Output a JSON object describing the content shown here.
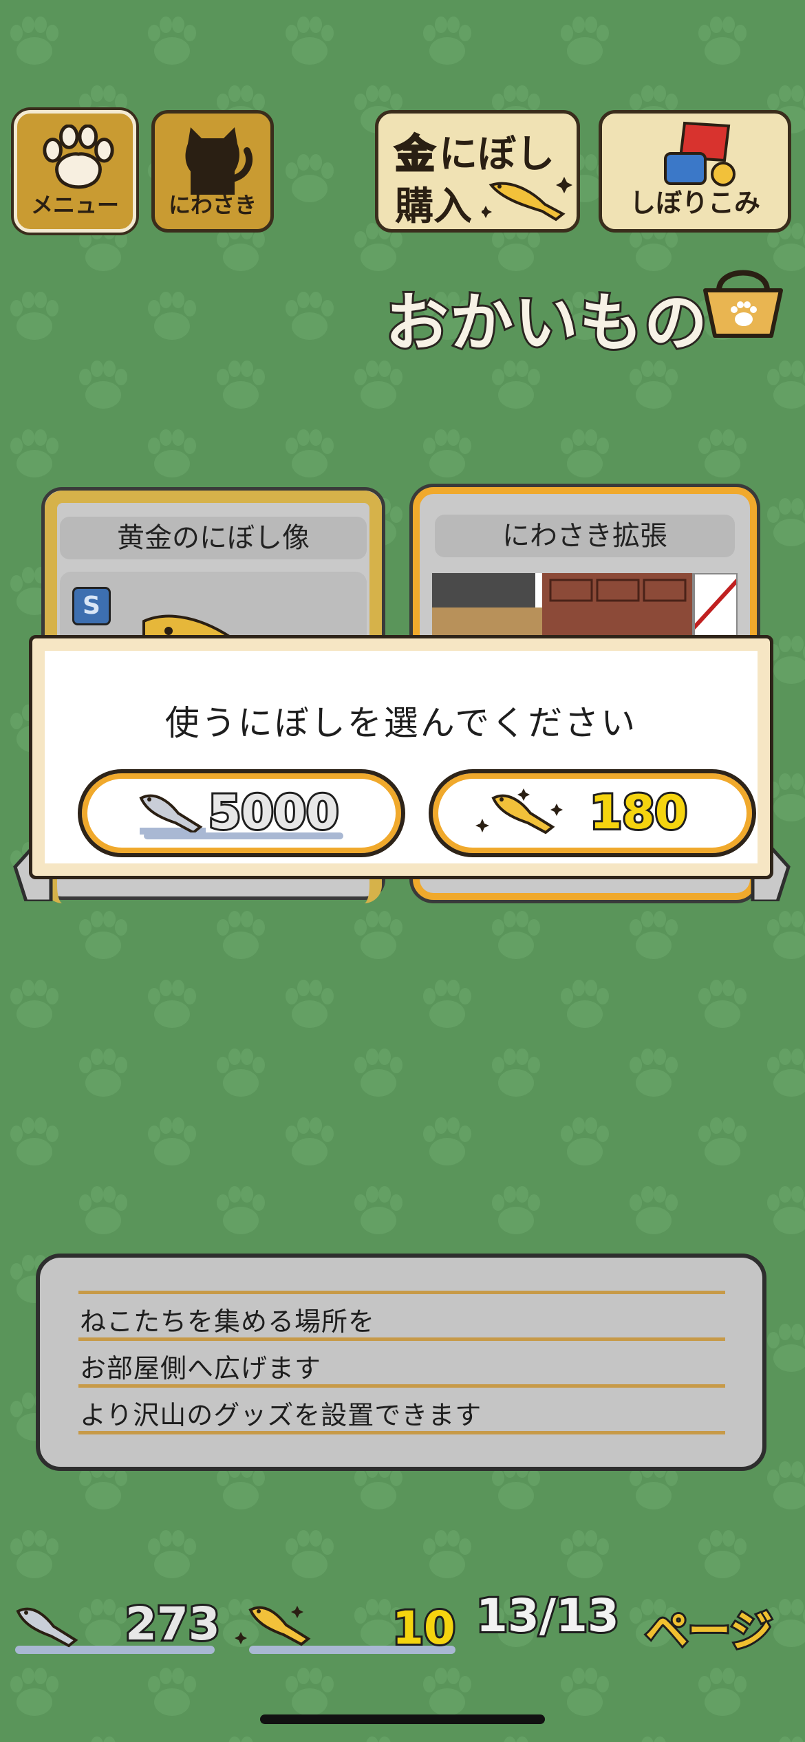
{
  "colors": {
    "background": "#5a955a",
    "gold": "#c99b32",
    "accent_orange": "#f0a92c",
    "yellow": "#f5d40f"
  },
  "top_buttons": {
    "menu_label": "メニュー",
    "yard_label": "にわさき",
    "buy_gold_line1_a": "金",
    "buy_gold_line1_b": "にぼし",
    "buy_gold_line2": "購入",
    "squeeze_label": "しぼりこみ"
  },
  "shop": {
    "title": "おかいもの",
    "icon": "basket-icon"
  },
  "cards": [
    {
      "title": "黄金のにぼし像",
      "badge": "S"
    },
    {
      "title": "にわさき拡張"
    }
  ],
  "modal": {
    "message": "使うにぼしを選んでください",
    "options": [
      {
        "icon": "silver-niboshi-icon",
        "amount": "5000"
      },
      {
        "icon": "gold-niboshi-icon",
        "amount": "180"
      }
    ]
  },
  "description": {
    "lines": [
      "ねこたちを集める場所を",
      "お部屋側へ広げます",
      "より沢山のグッズを設置できます"
    ]
  },
  "status_bar": {
    "silver_count": "273",
    "gold_count": "10",
    "page": "13/13",
    "page_label": "ページ"
  }
}
